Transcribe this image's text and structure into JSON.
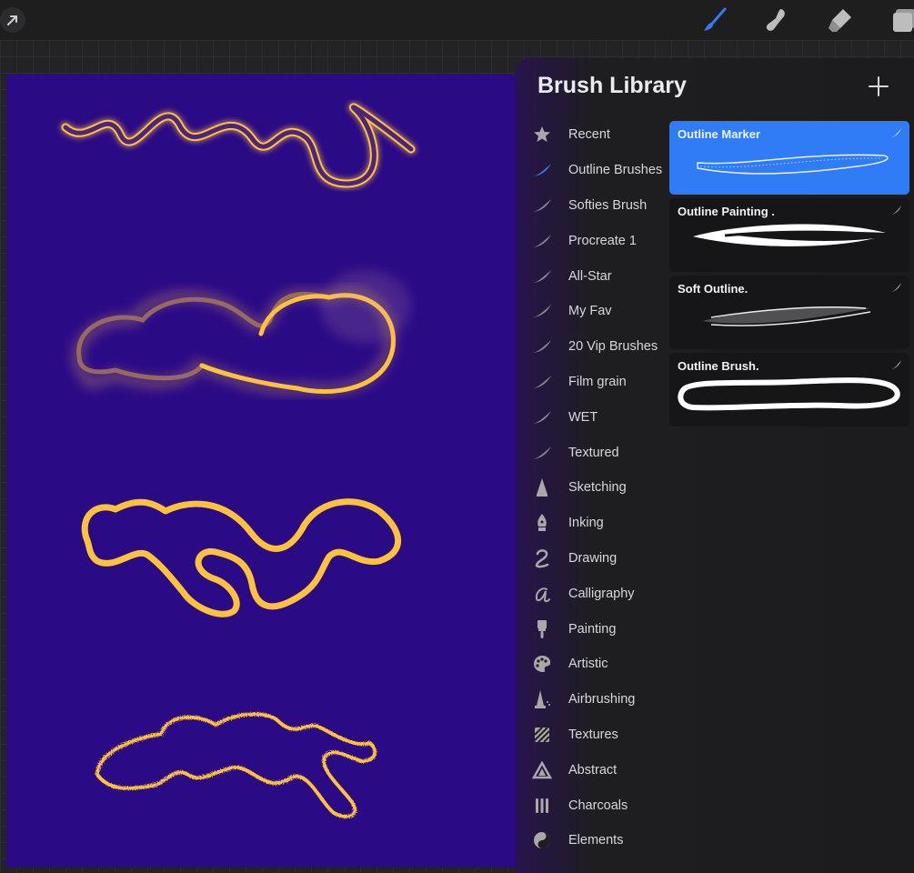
{
  "library": {
    "title": "Brush Library",
    "brush_sets": [
      {
        "label": "Recent",
        "icon": "star-icon"
      },
      {
        "label": "Outline Brushes",
        "icon": "brush-stroke-icon",
        "active": true
      },
      {
        "label": "Softies Brush",
        "icon": "brush-stroke-icon"
      },
      {
        "label": "Procreate 1",
        "icon": "brush-stroke-icon"
      },
      {
        "label": "All-Star",
        "icon": "brush-stroke-icon"
      },
      {
        "label": "My Fav",
        "icon": "brush-stroke-icon"
      },
      {
        "label": "20 Vip Brushes",
        "icon": "brush-stroke-icon"
      },
      {
        "label": "Film grain",
        "icon": "brush-stroke-icon"
      },
      {
        "label": "WET",
        "icon": "brush-stroke-icon"
      },
      {
        "label": "Textured",
        "icon": "brush-stroke-icon"
      },
      {
        "label": "Sketching",
        "icon": "pencil-tip-icon"
      },
      {
        "label": "Inking",
        "icon": "pen-nib-icon"
      },
      {
        "label": "Drawing",
        "icon": "squiggle-icon"
      },
      {
        "label": "Calligraphy",
        "icon": "calligraphy-a-icon"
      },
      {
        "label": "Painting",
        "icon": "paint-brush-icon"
      },
      {
        "label": "Artistic",
        "icon": "palette-icon"
      },
      {
        "label": "Airbrushing",
        "icon": "airbrush-icon"
      },
      {
        "label": "Textures",
        "icon": "hatch-square-icon"
      },
      {
        "label": "Abstract",
        "icon": "triangle-icon"
      },
      {
        "label": "Charcoals",
        "icon": "charcoal-sticks-icon"
      },
      {
        "label": "Elements",
        "icon": "yin-yang-icon"
      }
    ],
    "brushes": [
      {
        "name": "Outline Marker",
        "selected": true
      },
      {
        "name": "Outline Painting .",
        "selected": false
      },
      {
        "name": "Soft Outline.",
        "selected": false
      },
      {
        "name": "Outline Brush.",
        "selected": false
      }
    ]
  },
  "colors": {
    "canvas": "#2b0a86",
    "stroke": "#ffc23a",
    "accent": "#2f7cf6"
  }
}
